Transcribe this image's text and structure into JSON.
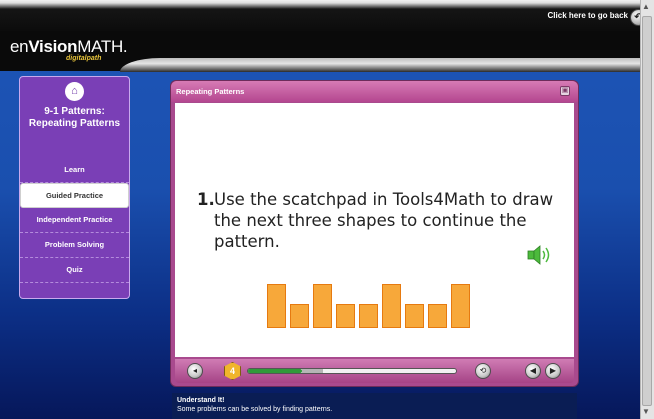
{
  "header": {
    "back_link": "Click here to go back",
    "logo_prefix": "en",
    "logo_bold": "Vision",
    "logo_rest": "MATH",
    "logo_sub": "digitalpath"
  },
  "sidebar": {
    "lesson_title": "9-1 Patterns: Repeating Patterns",
    "items": [
      {
        "label": "Learn"
      },
      {
        "label": "Guided Practice",
        "active": true
      },
      {
        "label": "Independent Practice"
      },
      {
        "label": "Problem Solving"
      },
      {
        "label": "Quiz"
      }
    ]
  },
  "panel": {
    "title": "Repeating Patterns",
    "question_number": "1.",
    "question_text": "Use the scatchpad in Tools4Math to draw the next three shapes to continue the pattern."
  },
  "pattern": [
    "tall",
    "short",
    "tall",
    "short",
    "short",
    "tall",
    "short",
    "short",
    "tall"
  ],
  "controls": {
    "badge": "4",
    "progress": 0.26,
    "buffered": 0.36
  },
  "bottom": {
    "title": "Understand It!",
    "text": "Some problems can be solved by finding patterns."
  },
  "colors": {
    "accent": "#7a3fb6",
    "panel": "#a94a8e",
    "shape_fill": "#f7a83a",
    "shape_border": "#e67a10",
    "speaker": "#4cba3c"
  }
}
